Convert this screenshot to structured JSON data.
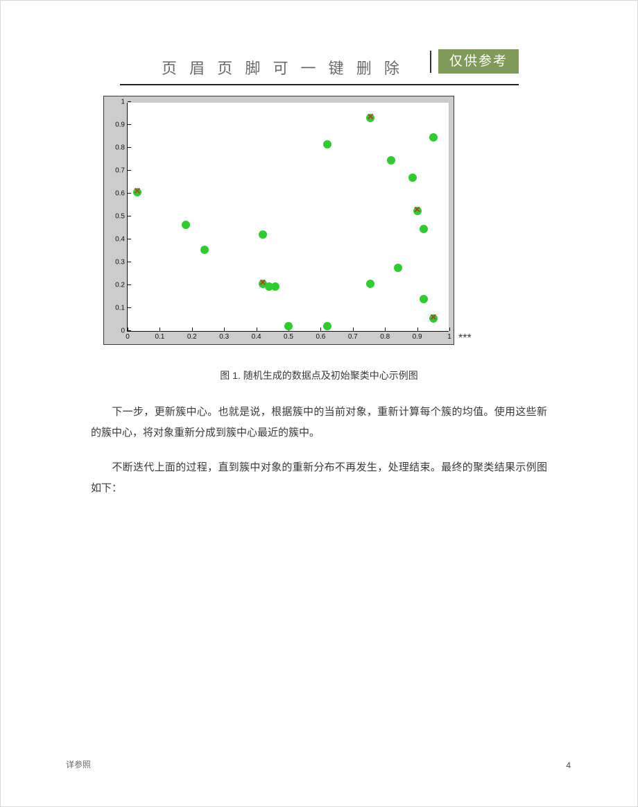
{
  "header": {
    "title": "页 眉 页 脚 可 一 键 删 除",
    "badge": "仅供参考"
  },
  "chart_data": {
    "type": "scatter",
    "xlabel": "",
    "ylabel": "",
    "xlim": [
      0,
      1
    ],
    "ylim": [
      0,
      1
    ],
    "x_ticks": [
      0,
      0.1,
      0.2,
      0.3,
      0.4,
      0.5,
      0.6,
      0.7,
      0.8,
      0.9,
      1
    ],
    "y_ticks": [
      0,
      0.1,
      0.2,
      0.3,
      0.4,
      0.5,
      0.6,
      0.7,
      0.8,
      0.9,
      1
    ],
    "series": [
      {
        "name": "data-points",
        "marker": "green-dot",
        "points": [
          [
            0.03,
            0.605
          ],
          [
            0.18,
            0.465
          ],
          [
            0.24,
            0.355
          ],
          [
            0.42,
            0.42
          ],
          [
            0.42,
            0.205
          ],
          [
            0.44,
            0.195
          ],
          [
            0.46,
            0.195
          ],
          [
            0.5,
            0.02
          ],
          [
            0.62,
            0.02
          ],
          [
            0.62,
            0.815
          ],
          [
            0.755,
            0.93
          ],
          [
            0.755,
            0.205
          ],
          [
            0.82,
            0.745
          ],
          [
            0.84,
            0.275
          ],
          [
            0.885,
            0.67
          ],
          [
            0.9,
            0.525
          ],
          [
            0.92,
            0.445
          ],
          [
            0.92,
            0.14
          ],
          [
            0.95,
            0.845
          ],
          [
            0.95,
            0.055
          ]
        ]
      },
      {
        "name": "initial-centers",
        "marker": "red-x",
        "points": [
          [
            0.03,
            0.605
          ],
          [
            0.42,
            0.205
          ],
          [
            0.755,
            0.93
          ],
          [
            0.9,
            0.525
          ],
          [
            0.95,
            0.055
          ]
        ]
      }
    ]
  },
  "figure_annotation": "***",
  "caption": "图 1. 随机生成的数据点及初始聚类中心示例图",
  "paragraphs": {
    "p1": "下一步，更新簇中心。也就是说，根据簇中的当前对象，重新计算每个簇的均值。使用这些新的簇中心，将对象重新分成到簇中心最近的簇中。",
    "p2": "不断迭代上面的过程，直到簇中对象的重新分布不再发生，处理结束。最终的聚类结果示例图如下："
  },
  "footer": {
    "left": "详参照",
    "page": "4"
  }
}
